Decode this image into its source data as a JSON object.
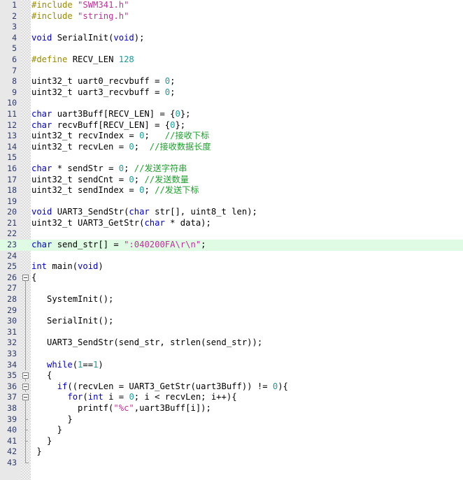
{
  "editor": {
    "language": "C",
    "first_line": 1,
    "last_line": 43,
    "colors": {
      "background": "#ffffff",
      "gutter_background": "#e8e8e8",
      "line_number": "#2e3b66",
      "keyword": "#0000d4",
      "preprocessor": "#9a8b00",
      "string": "#c0309a",
      "number": "#1c9a9a",
      "comment": "#1e9e2e",
      "plain_text": "#000000",
      "modified_line_highlight": "#e0fbe4",
      "fold_guide": "#9a9a9a"
    }
  },
  "lines": [
    {
      "n": 1,
      "fold": "none",
      "modified": false,
      "tokens": [
        {
          "t": "pre",
          "v": "#include"
        },
        {
          "t": "plain",
          "v": " "
        },
        {
          "t": "str",
          "v": "\"SWM341.h\""
        }
      ]
    },
    {
      "n": 2,
      "fold": "none",
      "modified": false,
      "tokens": [
        {
          "t": "pre",
          "v": "#include"
        },
        {
          "t": "plain",
          "v": " "
        },
        {
          "t": "str",
          "v": "\"string.h\""
        }
      ]
    },
    {
      "n": 3,
      "fold": "none",
      "modified": false,
      "tokens": []
    },
    {
      "n": 4,
      "fold": "none",
      "modified": false,
      "tokens": [
        {
          "t": "kw",
          "v": "void"
        },
        {
          "t": "plain",
          "v": " SerialInit("
        },
        {
          "t": "kw",
          "v": "void"
        },
        {
          "t": "plain",
          "v": ");"
        }
      ]
    },
    {
      "n": 5,
      "fold": "none",
      "modified": false,
      "tokens": []
    },
    {
      "n": 6,
      "fold": "none",
      "modified": false,
      "tokens": [
        {
          "t": "pre",
          "v": "#define"
        },
        {
          "t": "plain",
          "v": " RECV_LEN "
        },
        {
          "t": "num",
          "v": "128"
        }
      ]
    },
    {
      "n": 7,
      "fold": "none",
      "modified": false,
      "tokens": []
    },
    {
      "n": 8,
      "fold": "none",
      "modified": false,
      "tokens": [
        {
          "t": "plain",
          "v": "uint32_t uart0_recvbuff = "
        },
        {
          "t": "num",
          "v": "0"
        },
        {
          "t": "plain",
          "v": ";"
        }
      ]
    },
    {
      "n": 9,
      "fold": "none",
      "modified": false,
      "tokens": [
        {
          "t": "plain",
          "v": "uint32_t uart3_recvbuff = "
        },
        {
          "t": "num",
          "v": "0"
        },
        {
          "t": "plain",
          "v": ";"
        }
      ]
    },
    {
      "n": 10,
      "fold": "none",
      "modified": false,
      "tokens": []
    },
    {
      "n": 11,
      "fold": "none",
      "modified": false,
      "tokens": [
        {
          "t": "kw",
          "v": "char"
        },
        {
          "t": "plain",
          "v": " uart3Buff[RECV_LEN] = {"
        },
        {
          "t": "num",
          "v": "0"
        },
        {
          "t": "plain",
          "v": "};"
        }
      ]
    },
    {
      "n": 12,
      "fold": "none",
      "modified": false,
      "tokens": [
        {
          "t": "kw",
          "v": "char"
        },
        {
          "t": "plain",
          "v": " recvBuff[RECV_LEN] = {"
        },
        {
          "t": "num",
          "v": "0"
        },
        {
          "t": "plain",
          "v": "};"
        }
      ]
    },
    {
      "n": 13,
      "fold": "none",
      "modified": false,
      "tokens": [
        {
          "t": "plain",
          "v": "uint32_t recvIndex = "
        },
        {
          "t": "num",
          "v": "0"
        },
        {
          "t": "plain",
          "v": ";   "
        },
        {
          "t": "cmt",
          "v": "//接收下标"
        }
      ]
    },
    {
      "n": 14,
      "fold": "none",
      "modified": false,
      "tokens": [
        {
          "t": "plain",
          "v": "uint32_t recvLen = "
        },
        {
          "t": "num",
          "v": "0"
        },
        {
          "t": "plain",
          "v": ";  "
        },
        {
          "t": "cmt",
          "v": "//接收数据长度"
        }
      ]
    },
    {
      "n": 15,
      "fold": "none",
      "modified": false,
      "tokens": []
    },
    {
      "n": 16,
      "fold": "none",
      "modified": false,
      "tokens": [
        {
          "t": "kw",
          "v": "char"
        },
        {
          "t": "plain",
          "v": " * sendStr = "
        },
        {
          "t": "num",
          "v": "0"
        },
        {
          "t": "plain",
          "v": "; "
        },
        {
          "t": "cmt",
          "v": "//发送字符串"
        }
      ]
    },
    {
      "n": 17,
      "fold": "none",
      "modified": false,
      "tokens": [
        {
          "t": "plain",
          "v": "uint32_t sendCnt = "
        },
        {
          "t": "num",
          "v": "0"
        },
        {
          "t": "plain",
          "v": "; "
        },
        {
          "t": "cmt",
          "v": "//发送数量"
        }
      ]
    },
    {
      "n": 18,
      "fold": "none",
      "modified": false,
      "tokens": [
        {
          "t": "plain",
          "v": "uint32_t sendIndex = "
        },
        {
          "t": "num",
          "v": "0"
        },
        {
          "t": "plain",
          "v": "; "
        },
        {
          "t": "cmt",
          "v": "//发送下标"
        }
      ]
    },
    {
      "n": 19,
      "fold": "none",
      "modified": false,
      "tokens": []
    },
    {
      "n": 20,
      "fold": "none",
      "modified": false,
      "tokens": [
        {
          "t": "kw",
          "v": "void"
        },
        {
          "t": "plain",
          "v": " UART3_SendStr("
        },
        {
          "t": "kw",
          "v": "char"
        },
        {
          "t": "plain",
          "v": " str[], uint8_t len);"
        }
      ]
    },
    {
      "n": 21,
      "fold": "none",
      "modified": false,
      "tokens": [
        {
          "t": "plain",
          "v": "uint32_t UART3_GetStr("
        },
        {
          "t": "kw",
          "v": "char"
        },
        {
          "t": "plain",
          "v": " * data);"
        }
      ]
    },
    {
      "n": 22,
      "fold": "none",
      "modified": false,
      "tokens": []
    },
    {
      "n": 23,
      "fold": "none",
      "modified": true,
      "tokens": [
        {
          "t": "kw",
          "v": "char"
        },
        {
          "t": "plain",
          "v": " send_str[] = "
        },
        {
          "t": "str",
          "v": "\":040200FA\\r\\n\""
        },
        {
          "t": "plain",
          "v": ";"
        }
      ]
    },
    {
      "n": 24,
      "fold": "none",
      "modified": false,
      "tokens": []
    },
    {
      "n": 25,
      "fold": "none",
      "modified": false,
      "tokens": [
        {
          "t": "kw",
          "v": "int"
        },
        {
          "t": "plain",
          "v": " main("
        },
        {
          "t": "kw",
          "v": "void"
        },
        {
          "t": "plain",
          "v": ")"
        }
      ]
    },
    {
      "n": 26,
      "fold": "box",
      "modified": false,
      "tokens": [
        {
          "t": "plain",
          "v": "{"
        }
      ]
    },
    {
      "n": 27,
      "fold": "line",
      "modified": false,
      "tokens": []
    },
    {
      "n": 28,
      "fold": "line",
      "modified": false,
      "tokens": [
        {
          "t": "plain",
          "v": "   SystemInit();"
        }
      ]
    },
    {
      "n": 29,
      "fold": "line",
      "modified": false,
      "tokens": []
    },
    {
      "n": 30,
      "fold": "line",
      "modified": false,
      "tokens": [
        {
          "t": "plain",
          "v": "   SerialInit();"
        }
      ]
    },
    {
      "n": 31,
      "fold": "line",
      "modified": false,
      "tokens": []
    },
    {
      "n": 32,
      "fold": "line",
      "modified": false,
      "tokens": [
        {
          "t": "plain",
          "v": "   UART3_SendStr(send_str, strlen(send_str));"
        }
      ]
    },
    {
      "n": 33,
      "fold": "line",
      "modified": false,
      "tokens": []
    },
    {
      "n": 34,
      "fold": "line",
      "modified": false,
      "tokens": [
        {
          "t": "plain",
          "v": "   "
        },
        {
          "t": "kw",
          "v": "while"
        },
        {
          "t": "plain",
          "v": "("
        },
        {
          "t": "num",
          "v": "1"
        },
        {
          "t": "plain",
          "v": "=="
        },
        {
          "t": "num",
          "v": "1"
        },
        {
          "t": "plain",
          "v": ")"
        }
      ]
    },
    {
      "n": 35,
      "fold": "box",
      "modified": false,
      "tokens": [
        {
          "t": "plain",
          "v": "   {"
        }
      ]
    },
    {
      "n": 36,
      "fold": "box",
      "modified": false,
      "tokens": [
        {
          "t": "plain",
          "v": "     "
        },
        {
          "t": "kw",
          "v": "if"
        },
        {
          "t": "plain",
          "v": "((recvLen = UART3_GetStr(uart3Buff)) != "
        },
        {
          "t": "num",
          "v": "0"
        },
        {
          "t": "plain",
          "v": "){"
        }
      ]
    },
    {
      "n": 37,
      "fold": "box",
      "modified": false,
      "tokens": [
        {
          "t": "plain",
          "v": "       "
        },
        {
          "t": "kw",
          "v": "for"
        },
        {
          "t": "plain",
          "v": "("
        },
        {
          "t": "kw",
          "v": "int"
        },
        {
          "t": "plain",
          "v": " i = "
        },
        {
          "t": "num",
          "v": "0"
        },
        {
          "t": "plain",
          "v": "; i < recvLen; i++){"
        }
      ]
    },
    {
      "n": 38,
      "fold": "line",
      "modified": false,
      "tokens": [
        {
          "t": "plain",
          "v": "         printf("
        },
        {
          "t": "str",
          "v": "\"%c\""
        },
        {
          "t": "plain",
          "v": ",uart3Buff[i]);"
        }
      ]
    },
    {
      "n": 39,
      "fold": "tick",
      "modified": false,
      "tokens": [
        {
          "t": "plain",
          "v": "       }"
        }
      ]
    },
    {
      "n": 40,
      "fold": "tick",
      "modified": false,
      "tokens": [
        {
          "t": "plain",
          "v": "     }"
        }
      ]
    },
    {
      "n": 41,
      "fold": "tick",
      "modified": false,
      "tokens": [
        {
          "t": "plain",
          "v": "   }"
        }
      ]
    },
    {
      "n": 42,
      "fold": "line",
      "modified": false,
      "tokens": [
        {
          "t": "plain",
          "v": " }"
        }
      ]
    },
    {
      "n": 43,
      "fold": "end",
      "modified": false,
      "tokens": []
    }
  ]
}
